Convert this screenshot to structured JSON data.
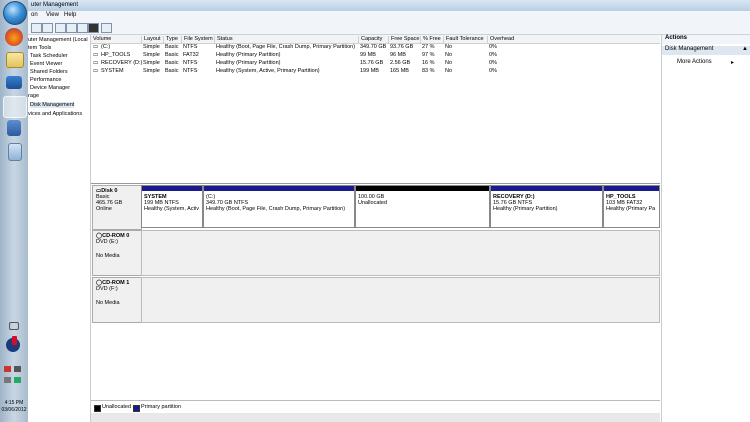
{
  "window": {
    "title": "uter Management"
  },
  "menu": [
    "on",
    "View",
    "Help"
  ],
  "tree": {
    "items": [
      {
        "label": "uter Management (Local"
      },
      {
        "label": "tem Tools"
      },
      {
        "label": "Task Scheduler"
      },
      {
        "label": "Event Viewer"
      },
      {
        "label": "Shared Folders"
      },
      {
        "label": "Performance"
      },
      {
        "label": "Device Manager"
      },
      {
        "label": "rage"
      },
      {
        "label": "Disk Management"
      },
      {
        "label": "vices and Applications"
      }
    ]
  },
  "volume_table": {
    "headers": [
      "Volume",
      "Layout",
      "Type",
      "File System",
      "Status",
      "Capacity",
      "Free Space",
      "% Free",
      "Fault Tolerance",
      "Overhead"
    ],
    "rows": [
      [
        "(C:)",
        "Simple",
        "Basic",
        "NTFS",
        "Healthy (Boot, Page File, Crash Dump, Primary Partition)",
        "349.70 GB",
        "93.76 GB",
        "27 %",
        "No",
        "0%"
      ],
      [
        "HP_TOOLS",
        "Simple",
        "Basic",
        "FAT32",
        "Healthy (Primary Partition)",
        "99 MB",
        "96 MB",
        "97 %",
        "No",
        "0%"
      ],
      [
        "RECOVERY (D:)",
        "Simple",
        "Basic",
        "NTFS",
        "Healthy (Primary Partition)",
        "15.76 GB",
        "2.56 GB",
        "16 %",
        "No",
        "0%"
      ],
      [
        "SYSTEM",
        "Simple",
        "Basic",
        "NTFS",
        "Healthy (System, Active, Primary Partition)",
        "199 MB",
        "165 MB",
        "83 %",
        "No",
        "0%"
      ]
    ]
  },
  "disks": [
    {
      "name": "Disk 0",
      "type": "Basic",
      "size": "465.76 GB",
      "status": "Online",
      "partitions": [
        {
          "name": "SYSTEM",
          "detail": "199 MB NTFS",
          "status": "Healthy (System, Activ",
          "color": "blue"
        },
        {
          "name": "(C:)",
          "detail": "349.70 GB NTFS",
          "status": "Healthy (Boot, Page File, Crash Dump, Primary Partition)",
          "color": "blue"
        },
        {
          "name": "",
          "detail": "100.00 GB",
          "status": "Unallocated",
          "color": "black"
        },
        {
          "name": "RECOVERY (D:)",
          "detail": "15.76 GB NTFS",
          "status": "Healthy (Primary Partition)",
          "color": "blue"
        },
        {
          "name": "HP_TOOLS",
          "detail": "103 MB FAT32",
          "status": "Healthy (Primary Pa",
          "color": "blue"
        }
      ]
    },
    {
      "name": "CD-ROM 0",
      "type": "DVD (E:)",
      "size": "",
      "status": "No Media"
    },
    {
      "name": "CD-ROM 1",
      "type": "DVD (F:)",
      "size": "",
      "status": "No Media"
    }
  ],
  "legend": {
    "unallocated": "Unallocated",
    "primary": "Primary partition"
  },
  "actions": {
    "header": "Actions",
    "section": "Disk Management",
    "more": "More Actions"
  },
  "tray": {
    "time": "4:15 PM",
    "date": "03/06/2012"
  },
  "colors": {
    "primary": "#1a1a8c",
    "unallocated": "#000000"
  }
}
